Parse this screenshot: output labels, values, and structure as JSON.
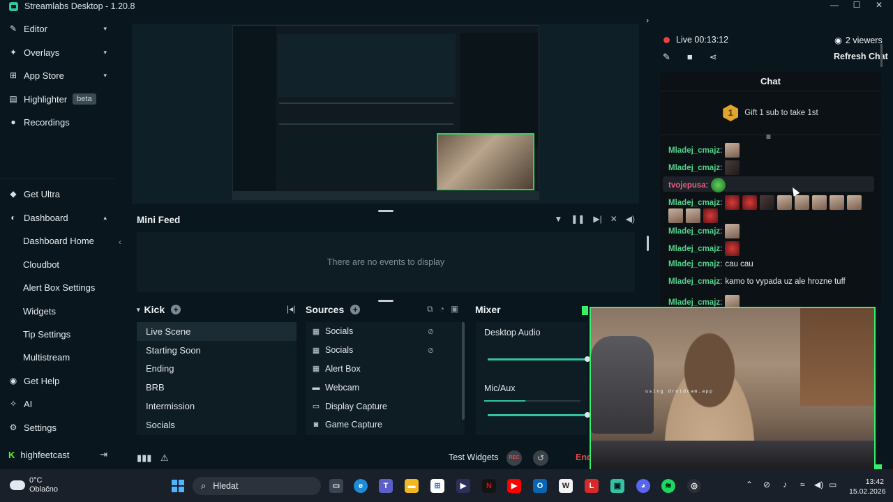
{
  "app": {
    "title": "Streamlabs Desktop - 1.20.8"
  },
  "sidebar": {
    "items": [
      {
        "label": "Editor",
        "icon": "brush-icon",
        "chevron": "▾"
      },
      {
        "label": "Overlays",
        "icon": "layers-icon",
        "chevron": "▾"
      },
      {
        "label": "App Store",
        "icon": "store-icon",
        "chevron": "▾"
      },
      {
        "label": "Highlighter",
        "icon": "film-icon",
        "badge": "beta"
      },
      {
        "label": "Recordings",
        "icon": "record-icon"
      }
    ],
    "lower": [
      {
        "label": "Get Ultra",
        "icon": "ultra-icon"
      },
      {
        "label": "Dashboard",
        "icon": "dashboard-icon",
        "chevron": "▴"
      }
    ],
    "dashboard_sub": [
      "Dashboard Home",
      "Cloudbot",
      "Alert Box Settings",
      "Widgets",
      "Tip Settings",
      "Multistream"
    ],
    "bottom": [
      {
        "label": "Get Help",
        "icon": "help-icon"
      },
      {
        "label": "AI",
        "icon": "ai-icon"
      },
      {
        "label": "Settings",
        "icon": "gear-icon"
      }
    ],
    "user": {
      "name": "highfeetcast",
      "platform": "K"
    }
  },
  "minifeed": {
    "title": "Mini Feed",
    "empty_text": "There are no events to display"
  },
  "scenes": {
    "title": "Kick",
    "items": [
      "Live Scene",
      "Starting Soon",
      "Ending",
      "BRB",
      "Intermission",
      "Socials"
    ],
    "active_index": 0
  },
  "sources": {
    "title": "Sources",
    "items": [
      {
        "label": "Socials",
        "icon": "browser-source-icon",
        "hidden": true
      },
      {
        "label": "Socials",
        "icon": "browser-source-icon",
        "hidden": true
      },
      {
        "label": "Alert Box",
        "icon": "browser-source-icon",
        "hidden": false
      },
      {
        "label": "Webcam",
        "icon": "folder-icon",
        "hidden": false
      },
      {
        "label": "Display Capture",
        "icon": "monitor-icon",
        "hidden": false
      },
      {
        "label": "Game Capture",
        "icon": "gamepad-icon",
        "hidden": false
      }
    ]
  },
  "mixer": {
    "title": "Mixer",
    "channels": [
      {
        "name": "Desktop Audio",
        "level": 0.0,
        "volume": 1.0
      },
      {
        "name": "Mic/Aux",
        "level": 0.43,
        "volume": 1.0
      }
    ]
  },
  "footer": {
    "test_widgets": "Test Widgets",
    "rec": "REC",
    "end": "End"
  },
  "live": {
    "status": "Live",
    "time": "00:13:12",
    "viewers": "2 viewers",
    "refresh": "Refresh Chat"
  },
  "chat": {
    "title": "Chat",
    "gift": {
      "count": "1",
      "text": "Gift 1 sub to take 1st"
    },
    "messages": [
      {
        "user": "Mladej_cmajz",
        "text": "",
        "emotes": [
          "face"
        ]
      },
      {
        "user": "Mladej_cmajz",
        "text": "",
        "emotes": [
          "dark"
        ]
      },
      {
        "user": "tvojepusa",
        "text": "",
        "emotes": [
          "green"
        ],
        "highlight": true
      },
      {
        "user": "Mladej_cmajz",
        "text": "",
        "emotes": [
          "red",
          "red",
          "dark",
          "face",
          "face",
          "face",
          "face",
          "face",
          "face",
          "face",
          "red"
        ]
      },
      {
        "user": "Mladej_cmajz",
        "text": "",
        "emotes": [
          "face"
        ]
      },
      {
        "user": "Mladej_cmajz",
        "text": "",
        "emotes": [
          "red"
        ]
      },
      {
        "user": "Mladej_cmajz",
        "text": "cau cau",
        "emotes": []
      },
      {
        "user": "Mladej_cmajz",
        "text": "kamo to vypada uz ale hrozne tuff",
        "emotes": []
      },
      {
        "user": "Mladej_cmajz",
        "text": "",
        "emotes": [
          "face"
        ]
      }
    ]
  },
  "webcam": {
    "overlay_text": "using droidcam.app"
  },
  "taskbar": {
    "weather": {
      "temp": "0°C",
      "desc": "Oblačno"
    },
    "search_placeholder": "Hledat",
    "clock": {
      "time": "13:42",
      "date": "15.02.2026"
    }
  }
}
